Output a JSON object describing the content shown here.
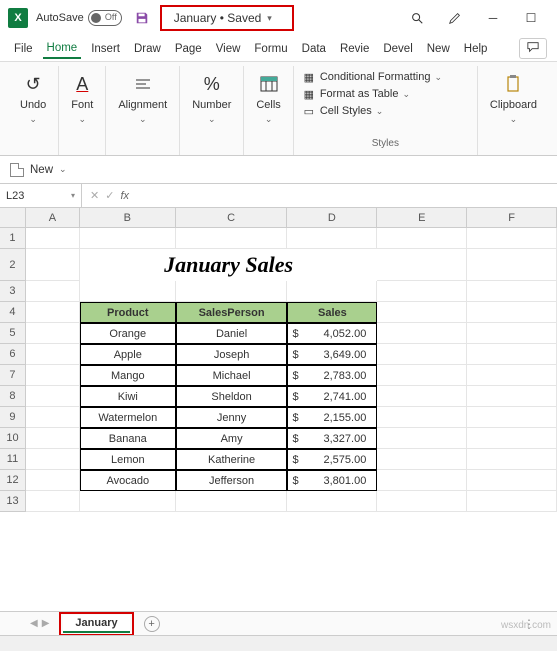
{
  "titlebar": {
    "autosave_label": "AutoSave",
    "autosave_state": "Off",
    "doc_title": "January • Saved"
  },
  "tabs": {
    "file": "File",
    "home": "Home",
    "insert": "Insert",
    "draw": "Draw",
    "page": "Page",
    "view": "View",
    "formu": "Formu",
    "data": "Data",
    "revie": "Revie",
    "devel": "Devel",
    "new": "New",
    "help": "Help"
  },
  "ribbon": {
    "undo": "Undo",
    "font": "Font",
    "alignment": "Alignment",
    "number": "Number",
    "cells": "Cells",
    "cond_fmt": "Conditional Formatting",
    "as_table": "Format as Table",
    "cell_styles": "Cell Styles",
    "styles_group": "Styles",
    "clipboard": "Clipboard"
  },
  "newdoc": {
    "label": "New"
  },
  "fbar": {
    "namebox": "L23",
    "fx": "fx"
  },
  "grid": {
    "cols": [
      "A",
      "B",
      "C",
      "D",
      "E",
      "F"
    ],
    "title": "January Sales",
    "headers": [
      "Product",
      "SalesPerson",
      "Sales"
    ],
    "rows": [
      {
        "product": "Orange",
        "person": "Daniel",
        "sales": "4,052.00"
      },
      {
        "product": "Apple",
        "person": "Joseph",
        "sales": "3,649.00"
      },
      {
        "product": "Mango",
        "person": "Michael",
        "sales": "2,783.00"
      },
      {
        "product": "Kiwi",
        "person": "Sheldon",
        "sales": "2,741.00"
      },
      {
        "product": "Watermelon",
        "person": "Jenny",
        "sales": "2,155.00"
      },
      {
        "product": "Banana",
        "person": "Amy",
        "sales": "3,327.00"
      },
      {
        "product": "Lemon",
        "person": "Katherine",
        "sales": "2,575.00"
      },
      {
        "product": "Avocado",
        "person": "Jefferson",
        "sales": "3,801.00"
      }
    ],
    "currency": "$"
  },
  "sheet": {
    "name": "January"
  },
  "watermark": "wsxdn.com"
}
